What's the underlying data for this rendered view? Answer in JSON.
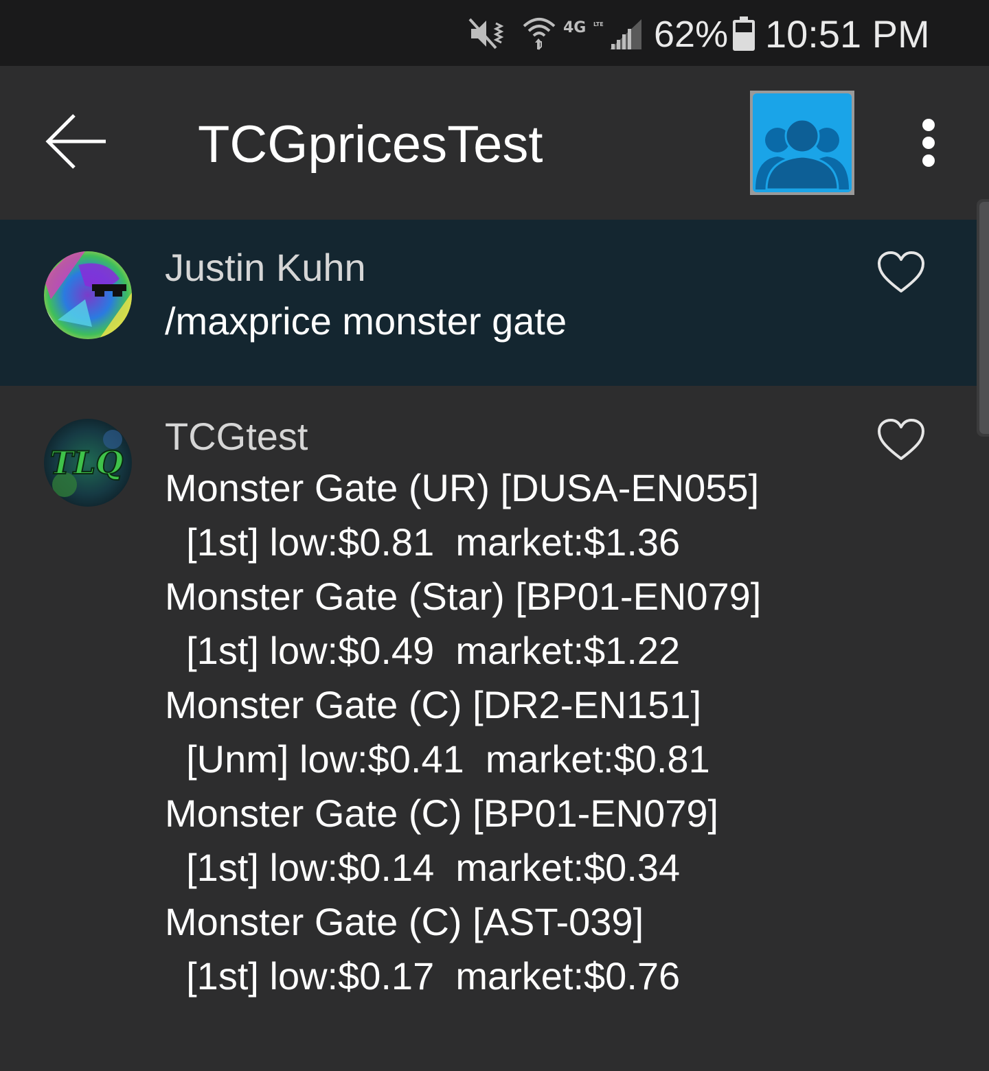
{
  "status_bar": {
    "network_type": "4G",
    "network_sub": "LTE",
    "battery_percent": "62%",
    "time": "10:51 PM",
    "icons": [
      "mute-icon",
      "wifi-icon",
      "signal-icon",
      "battery-icon"
    ]
  },
  "app_bar": {
    "title": "TCGpricesTest",
    "back_icon": "arrow-left-icon",
    "group_icon": "group-people-icon",
    "menu_icon": "more-vertical-icon",
    "group_avatar_color": "#1aa4e8"
  },
  "messages": [
    {
      "sender": "Justin Kuhn",
      "text": "/maxprice monster gate",
      "highlighted": true,
      "like_icon": "heart-outline-icon"
    },
    {
      "sender": "TCGtest",
      "avatar_text": "TLQ",
      "lines": [
        "Monster Gate (UR) [DUSA-EN055]",
        "  [1st] low:$0.81  market:$1.36",
        "Monster Gate (Star) [BP01-EN079]",
        "  [1st] low:$0.49  market:$1.22",
        "Monster Gate (C) [DR2-EN151]",
        "  [Unm] low:$0.41  market:$0.81",
        "Monster Gate (C) [BP01-EN079]",
        "  [1st] low:$0.14  market:$0.34",
        "Monster Gate (C) [AST-039]",
        "  [1st] low:$0.17  market:$0.76"
      ],
      "highlighted": false,
      "like_icon": "heart-outline-icon"
    }
  ],
  "colors": {
    "background": "#2d2d2e",
    "status_bar": "#1a1a1b",
    "highlight_row": "#142630",
    "accent": "#1aa4e8"
  }
}
